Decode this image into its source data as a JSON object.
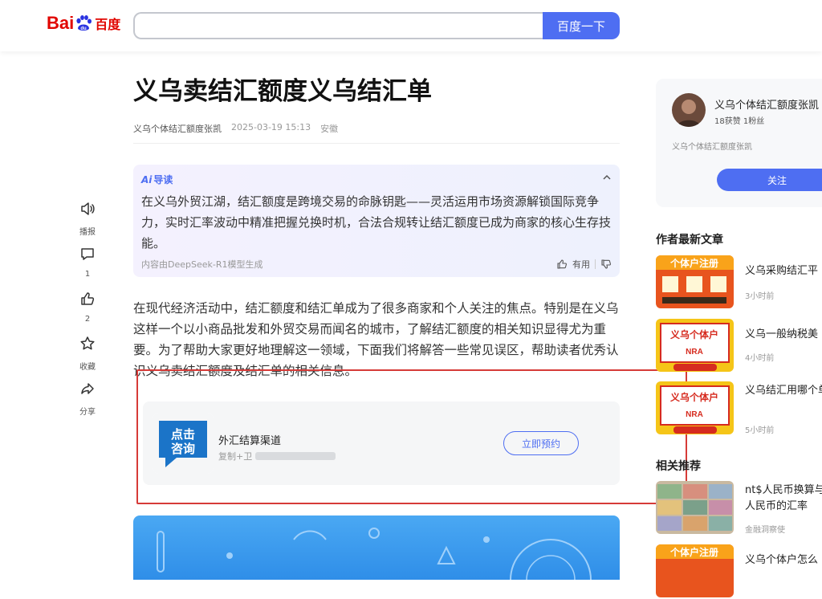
{
  "header": {
    "logo_text_1": "Bai",
    "logo_text_2": "du",
    "logo_text_cn": "百度",
    "search_value": "",
    "search_button": "百度一下"
  },
  "side_actions": [
    {
      "icon": "speaker-icon",
      "label": "播报"
    },
    {
      "icon": "comment-icon",
      "label": "1"
    },
    {
      "icon": "thumbs-up-icon",
      "label": "2"
    },
    {
      "icon": "star-icon",
      "label": "收藏"
    },
    {
      "icon": "share-icon",
      "label": "分享"
    }
  ],
  "article": {
    "title": "义乌卖结汇额度义乌结汇单",
    "author": "义乌个体结汇额度张凯",
    "date": "2025-03-19 15:13",
    "location": "安徽",
    "ai_label": "导读",
    "ai_mark": "Ai",
    "ai_text": "在义乌外贸江湖，结汇额度是跨境交易的命脉钥匙——灵活运用市场资源解锁国际竞争力，实时汇率波动中精准把握兑换时机，合法合规转让结汇额度已成为商家的核心生存技能。",
    "ai_source": "内容由DeepSeek-R1模型生成",
    "ai_useful": "有用",
    "body": "在现代经济活动中，结汇额度和结汇单成为了很多商家和个人关注的焦点。特别是在义乌这样一个以小商品批发和外贸交易而闻名的城市，了解结汇额度的相关知识显得尤为重要。为了帮助大家更好地理解这一领域，下面我们将解答一些常见误区，帮助读者优秀认识义乌卖结汇额度及结汇单的相关信息。"
  },
  "ad": {
    "image_text_1": "点击",
    "image_text_2": "咨询",
    "name": "外汇结算渠道",
    "sub": "复制+卫",
    "button": "立即预约"
  },
  "sidebar": {
    "author_name": "义乌个体结汇额度张凯",
    "author_stats": "18获赞 1粉丝",
    "author_desc": "义乌个体结汇额度张凯",
    "follow": "关注",
    "latest_title": "作者最新文章",
    "latest": [
      {
        "title": "义乌采购结汇平",
        "time": "3小时前",
        "thumb_text": "个体户注册"
      },
      {
        "title": "义乌一般纳税美",
        "time": "4小时前",
        "thumb_text": "义乌个体户"
      },
      {
        "title": "义乌结汇用哪个单",
        "time": "5小时前",
        "thumb_text": "义乌个体户"
      }
    ],
    "related_title": "相关推荐",
    "related": [
      {
        "title": "nt$人民币换算与人民币的汇率",
        "time": "金融洞察使",
        "thumb_text": ""
      },
      {
        "title": "义乌个体户怎么",
        "time": "",
        "thumb_text": "个体户注册"
      }
    ]
  },
  "colors": {
    "brand_blue": "#4e6ef2",
    "baidu_red": "#e10601",
    "annotation_red": "#d63b38"
  }
}
